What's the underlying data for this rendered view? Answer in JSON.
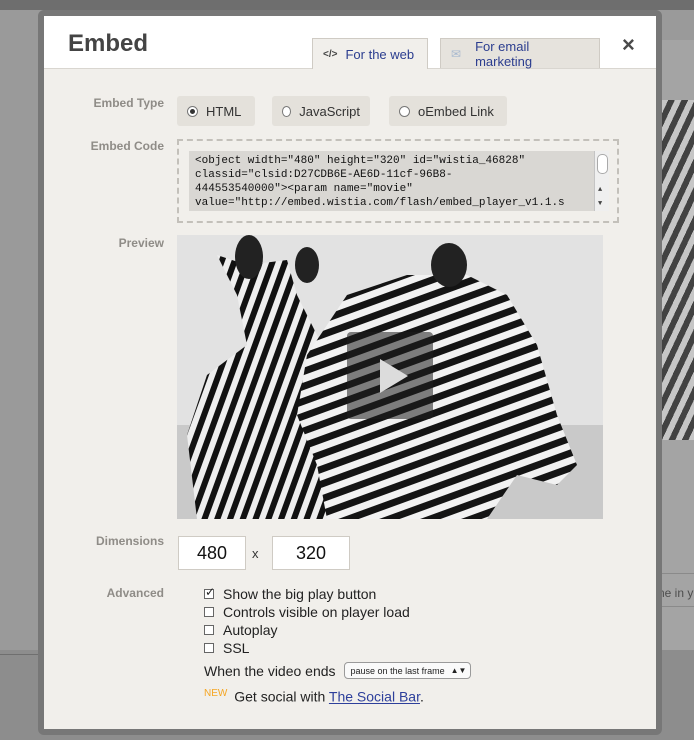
{
  "modal": {
    "title": "Embed",
    "tabs": [
      {
        "icon": "</>",
        "label": "For the web",
        "active": true
      },
      {
        "icon": "envelope",
        "label": "For email marketing",
        "active": false
      }
    ],
    "close_label": "×"
  },
  "labels": {
    "embed_type": "Embed Type",
    "embed_code": "Embed Code",
    "preview": "Preview",
    "dimensions": "Dimensions",
    "advanced": "Advanced"
  },
  "embed_types": [
    {
      "label": "HTML",
      "selected": true
    },
    {
      "label": "JavaScript",
      "selected": false
    },
    {
      "label": "oEmbed Link",
      "selected": false
    }
  ],
  "embed_code": {
    "lines": [
      "<object width=\"480\" height=\"320\" id=\"wistia_46828\"",
      "classid=\"clsid:D27CDB6E-AE6D-11cf-96B8-",
      "444553540000\"><param name=\"movie\"",
      "value=\"http://embed.wistia.com/flash/embed_player_v1.1.s"
    ]
  },
  "dimensions": {
    "width": "480",
    "separator": "x",
    "height": "320"
  },
  "advanced": {
    "options": [
      {
        "label": "Show the big play button",
        "checked": true
      },
      {
        "label": "Controls visible on player load",
        "checked": false
      },
      {
        "label": "Autoplay",
        "checked": false
      },
      {
        "label": "SSL",
        "checked": false
      }
    ],
    "video_end_label": "When the video ends",
    "video_end_value": "pause on the last frame",
    "social_new": "NEW",
    "social_text": "Get social with",
    "social_link": "The Social Bar",
    "social_period": "."
  },
  "background": {
    "partial_text": "ne in y"
  }
}
